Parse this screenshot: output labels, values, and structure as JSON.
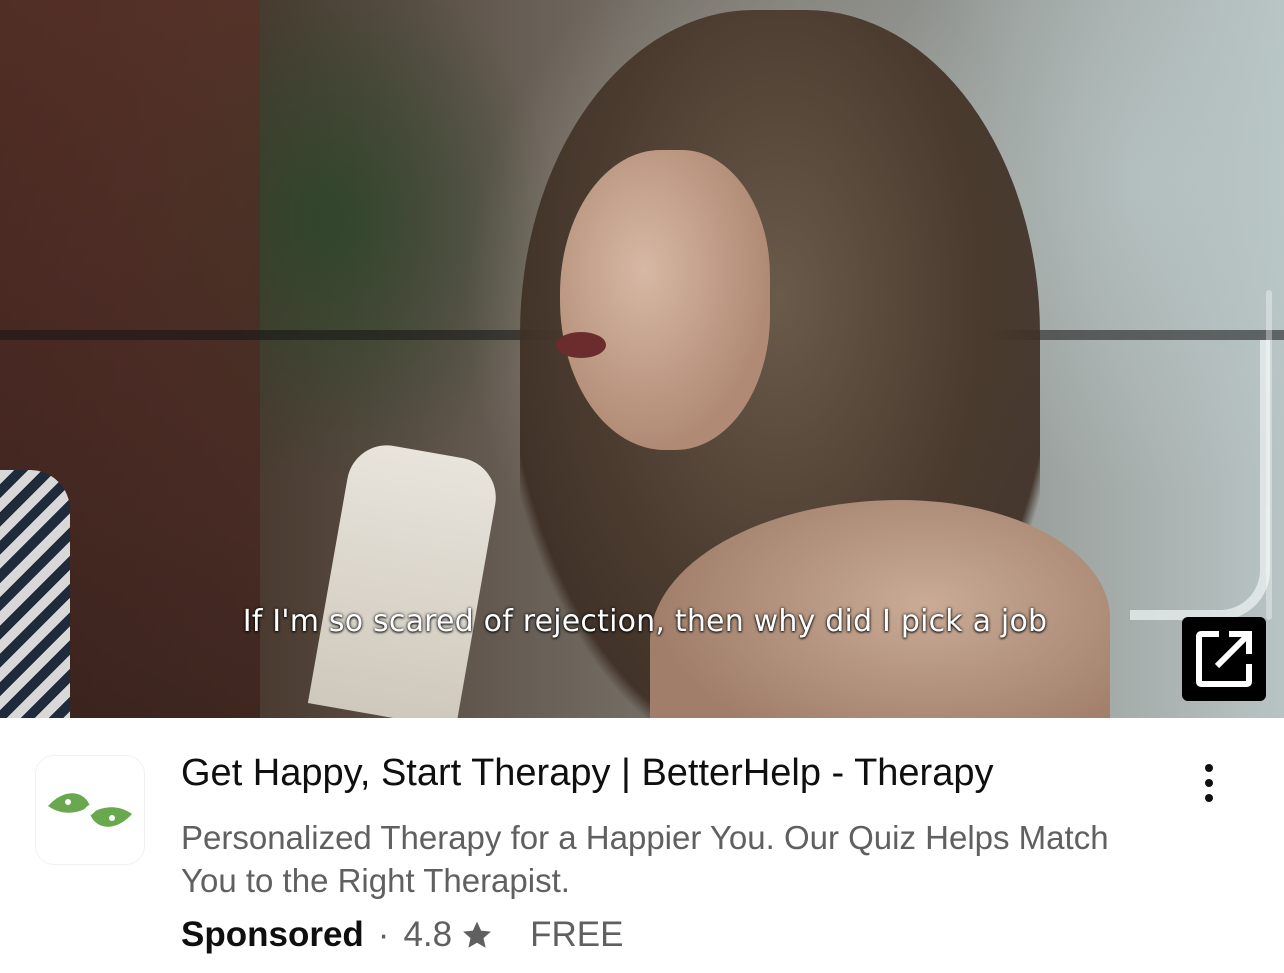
{
  "video": {
    "caption": "If I'm so scared of rejection, then why did I pick a job",
    "open_icon": "open-in-new-icon"
  },
  "ad": {
    "logo_icon": "betterhelp-leaf-logo",
    "title": "Get Happy, Start Therapy | BetterHelp - Therapy",
    "description": "Personalized Therapy for a Happier You. Our Quiz Helps Match You to the Right Therapist.",
    "sponsored_label": "Sponsored",
    "separator": "·",
    "rating": "4.8",
    "rating_icon": "star-icon",
    "price": "FREE",
    "menu_icon": "more-vert-icon"
  },
  "colors": {
    "title_text": "#0f0f0f",
    "secondary_text": "#606060",
    "logo_green": "#6aa84f"
  }
}
